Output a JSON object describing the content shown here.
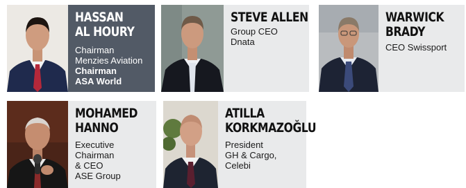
{
  "people": [
    {
      "name_lines": [
        "HASSAN",
        "AL HOURY"
      ],
      "roles": [
        {
          "text": "Chairman",
          "bold": false
        },
        {
          "text": "Menzies Aviation",
          "bold": false
        },
        {
          "text": "Chairman",
          "bold": true
        },
        {
          "text": "ASA World",
          "bold": true
        }
      ]
    },
    {
      "name_lines": [
        "STEVE ALLEN"
      ],
      "roles": [
        {
          "text": "Group CEO",
          "bold": false
        },
        {
          "text": "Dnata",
          "bold": false
        }
      ]
    },
    {
      "name_lines": [
        "WARWICK",
        "BRADY"
      ],
      "roles": [
        {
          "text": "CEO Swissport",
          "bold": false
        }
      ]
    },
    {
      "name_lines": [
        "MOHAMED",
        "HANNO"
      ],
      "roles": [
        {
          "text": "Executive",
          "bold": false
        },
        {
          "text": "Chairman",
          "bold": false
        },
        {
          "text": "& CEO",
          "bold": false
        },
        {
          "text": "ASE Group",
          "bold": false
        }
      ]
    },
    {
      "name_lines": [
        "ATILLA",
        "KORKMAZOĞLU"
      ],
      "roles": [
        {
          "text": "President",
          "bold": false
        },
        {
          "text": "GH & Cargo,",
          "bold": false
        },
        {
          "text": "Celebi",
          "bold": false
        }
      ]
    }
  ],
  "colors": {
    "dark_card": "#525a66",
    "light_card": "#e9eaeb",
    "page_background": "#ffffff"
  }
}
